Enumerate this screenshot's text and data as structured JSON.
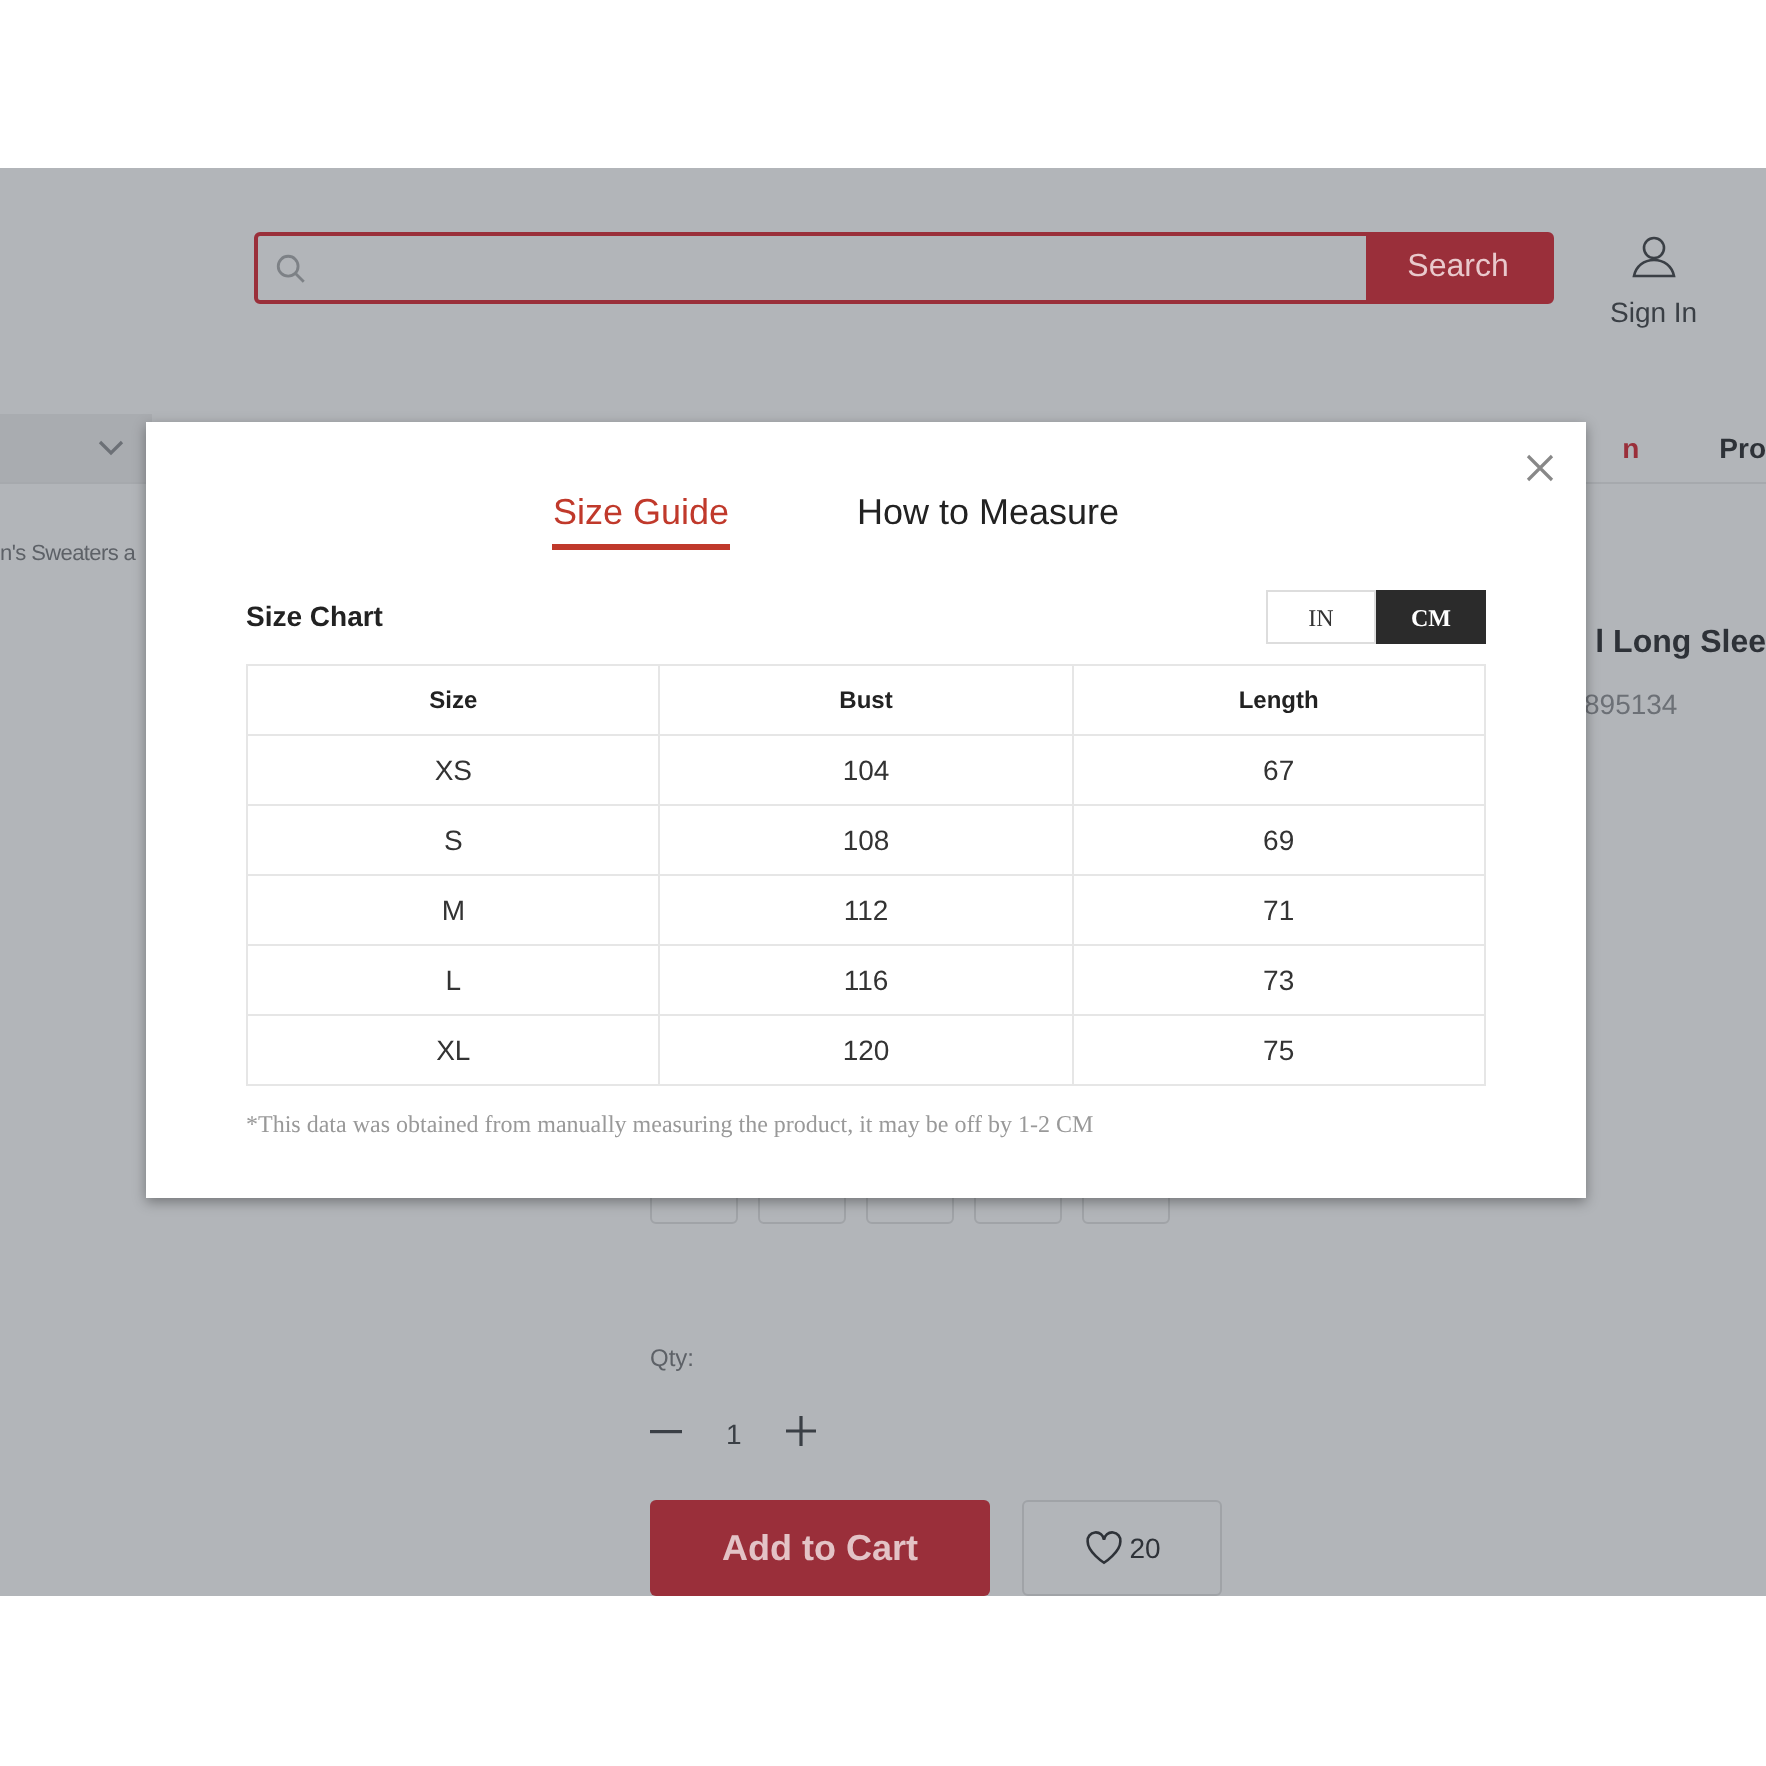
{
  "header": {
    "search_button": "Search",
    "account": "Sign In"
  },
  "nav": {
    "items": [
      {
        "label": "n",
        "selected": true
      },
      {
        "label": "Pro",
        "selected": false
      }
    ]
  },
  "breadcrumb": "n's Sweaters a",
  "product": {
    "title": "l Long Slee",
    "sku": "895134",
    "qty_label": "Qty:",
    "qty": "1",
    "add_to_cart": "Add to Cart",
    "wishlist_count": "20"
  },
  "modal": {
    "tabs": [
      {
        "label": "Size Guide",
        "selected": true
      },
      {
        "label": "How to Measure",
        "selected": false
      }
    ],
    "title": "Size Chart",
    "units": [
      {
        "label": "IN",
        "selected": false
      },
      {
        "label": "CM",
        "selected": true
      }
    ],
    "table": {
      "columns": [
        "Size",
        "Bust",
        "Length"
      ],
      "rows": [
        [
          "XS",
          "104",
          "67"
        ],
        [
          "S",
          "108",
          "69"
        ],
        [
          "M",
          "112",
          "71"
        ],
        [
          "L",
          "116",
          "73"
        ],
        [
          "XL",
          "120",
          "75"
        ]
      ]
    },
    "note": "*This data was obtained from manually measuring the product, it may be off by 1-2 CM"
  }
}
